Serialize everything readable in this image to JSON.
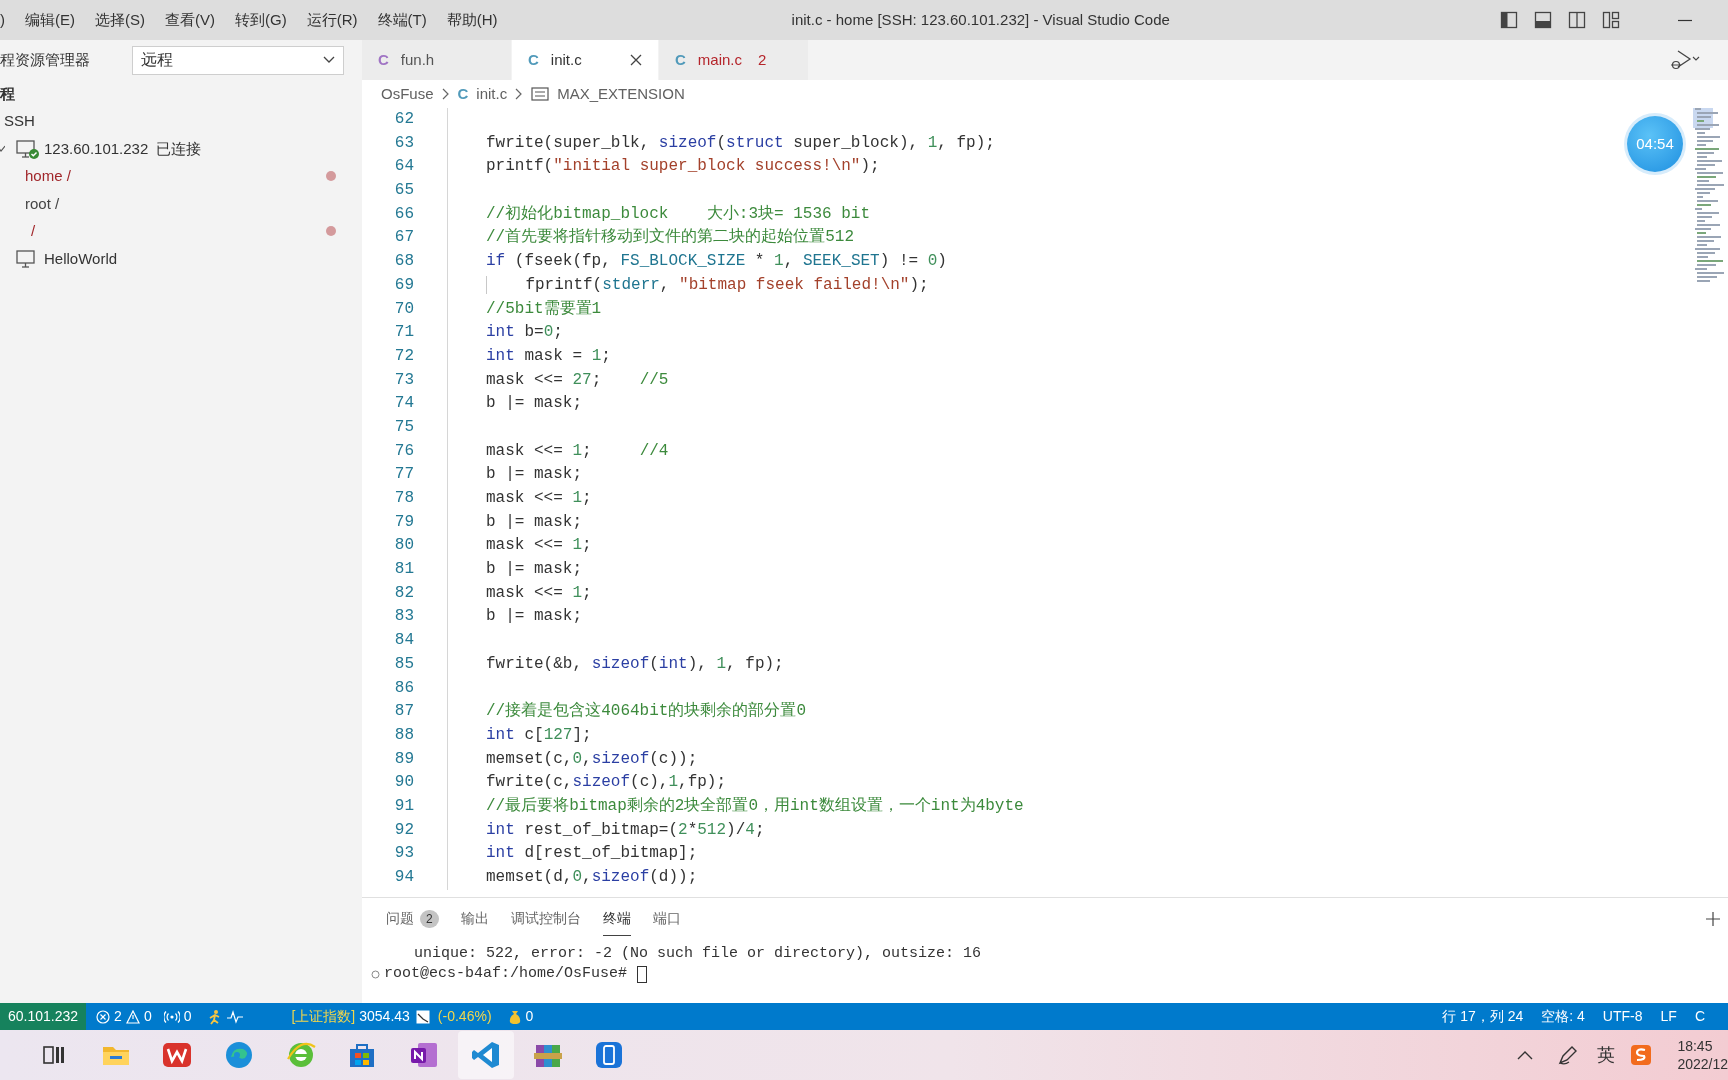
{
  "window": {
    "title": "init.c - home [SSH: 123.60.101.232] - Visual Studio Code"
  },
  "menu": [
    ")",
    "编辑(E)",
    "选择(S)",
    "查看(V)",
    "转到(G)",
    "运行(R)",
    "终端(T)",
    "帮助(H)"
  ],
  "sidebar": {
    "header": "程资源管理器",
    "dropdown": {
      "value": "远程"
    },
    "section": "程",
    "group": "SSH",
    "hosts": [
      {
        "label": "123.60.101.232",
        "status": "已连接",
        "connected": true,
        "expanded": true,
        "children": [
          {
            "name": "home",
            "separator": "/",
            "modified": true
          },
          {
            "name": "root",
            "separator": "/",
            "modified": false
          },
          {
            "separator": "/",
            "modified": true
          }
        ]
      },
      {
        "label": "HelloWorld",
        "connected": false
      }
    ]
  },
  "tabs": [
    {
      "label": "fun.h",
      "icon": "C",
      "color": "#a074c4",
      "selected": false
    },
    {
      "label": "init.c",
      "icon": "C",
      "color": "#519aba",
      "selected": true
    },
    {
      "label": "main.c",
      "icon": "C",
      "color": "#519aba",
      "selected": false,
      "problems": "2"
    }
  ],
  "breadcrumb": [
    {
      "kind": "folder",
      "text": "OsFuse"
    },
    {
      "kind": "file",
      "icon": "C",
      "text": "init.c"
    },
    {
      "kind": "symbol",
      "text": "MAX_EXTENSION"
    }
  ],
  "editor": {
    "lines": [
      {
        "number": "62"
      },
      {
        "number": "63",
        "tokens": [
          {
            "kind": "text",
            "text": "fwrite(super_blk, "
          },
          {
            "kind": "keyword",
            "text": "sizeof"
          },
          {
            "kind": "text",
            "text": "("
          },
          {
            "kind": "keyword",
            "text": "struct"
          },
          {
            "kind": "text",
            "text": " super_block), "
          },
          {
            "kind": "number",
            "text": "1"
          },
          {
            "kind": "text",
            "text": ", fp);"
          }
        ]
      },
      {
        "number": "64",
        "tokens": [
          {
            "kind": "text",
            "text": "printf("
          },
          {
            "kind": "string",
            "text": "\"initial super_block success!\\n\""
          },
          {
            "kind": "text",
            "text": ");"
          }
        ]
      },
      {
        "number": "65"
      },
      {
        "number": "66",
        "tokens": [
          {
            "kind": "comment",
            "text": "//初始化bitmap_block    大小:3块= 1536 bit"
          }
        ]
      },
      {
        "number": "67",
        "tokens": [
          {
            "kind": "comment",
            "text": "//首先要将指针移动到文件的第二块的起始位置512"
          }
        ]
      },
      {
        "number": "68",
        "tokens": [
          {
            "kind": "keyword",
            "text": "if"
          },
          {
            "kind": "text",
            "text": " (fseek(fp, "
          },
          {
            "kind": "constant",
            "text": "FS_BLOCK_SIZE"
          },
          {
            "kind": "text",
            "text": " * "
          },
          {
            "kind": "number",
            "text": "1"
          },
          {
            "kind": "text",
            "text": ", "
          },
          {
            "kind": "constant",
            "text": "SEEK_SET"
          },
          {
            "kind": "text",
            "text": ") != "
          },
          {
            "kind": "number",
            "text": "0"
          },
          {
            "kind": "text",
            "text": ")"
          }
        ]
      },
      {
        "number": "69",
        "indent_guide": true,
        "tokens": [
          {
            "kind": "text",
            "text": "    fprintf("
          },
          {
            "kind": "constant",
            "text": "stderr"
          },
          {
            "kind": "text",
            "text": ", "
          },
          {
            "kind": "string",
            "text": "\"bitmap fseek failed!\\n\""
          },
          {
            "kind": "text",
            "text": ");"
          }
        ]
      },
      {
        "number": "70",
        "tokens": [
          {
            "kind": "comment",
            "text": "//5bit需要置1"
          }
        ]
      },
      {
        "number": "71",
        "tokens": [
          {
            "kind": "keyword",
            "text": "int"
          },
          {
            "kind": "text",
            "text": " b="
          },
          {
            "kind": "number",
            "text": "0"
          },
          {
            "kind": "text",
            "text": ";"
          }
        ]
      },
      {
        "number": "72",
        "tokens": [
          {
            "kind": "keyword",
            "text": "int"
          },
          {
            "kind": "text",
            "text": " mask = "
          },
          {
            "kind": "number",
            "text": "1"
          },
          {
            "kind": "text",
            "text": ";"
          }
        ]
      },
      {
        "number": "73",
        "tokens": [
          {
            "kind": "text",
            "text": "mask <<= "
          },
          {
            "kind": "number",
            "text": "27"
          },
          {
            "kind": "text",
            "text": ";    "
          },
          {
            "kind": "comment",
            "text": "//5"
          }
        ]
      },
      {
        "number": "74",
        "tokens": [
          {
            "kind": "text",
            "text": "b |= mask;"
          }
        ]
      },
      {
        "number": "75"
      },
      {
        "number": "76",
        "tokens": [
          {
            "kind": "text",
            "text": "mask <<= "
          },
          {
            "kind": "number",
            "text": "1"
          },
          {
            "kind": "text",
            "text": ";     "
          },
          {
            "kind": "comment",
            "text": "//4"
          }
        ]
      },
      {
        "number": "77",
        "tokens": [
          {
            "kind": "text",
            "text": "b |= mask;"
          }
        ]
      },
      {
        "number": "78",
        "tokens": [
          {
            "kind": "text",
            "text": "mask <<= "
          },
          {
            "kind": "number",
            "text": "1"
          },
          {
            "kind": "text",
            "text": ";"
          }
        ]
      },
      {
        "number": "79",
        "tokens": [
          {
            "kind": "text",
            "text": "b |= mask;"
          }
        ]
      },
      {
        "number": "80",
        "tokens": [
          {
            "kind": "text",
            "text": "mask <<= "
          },
          {
            "kind": "number",
            "text": "1"
          },
          {
            "kind": "text",
            "text": ";"
          }
        ]
      },
      {
        "number": "81",
        "tokens": [
          {
            "kind": "text",
            "text": "b |= mask;"
          }
        ]
      },
      {
        "number": "82",
        "tokens": [
          {
            "kind": "text",
            "text": "mask <<= "
          },
          {
            "kind": "number",
            "text": "1"
          },
          {
            "kind": "text",
            "text": ";"
          }
        ]
      },
      {
        "number": "83",
        "tokens": [
          {
            "kind": "text",
            "text": "b |= mask;"
          }
        ]
      },
      {
        "number": "84"
      },
      {
        "number": "85",
        "tokens": [
          {
            "kind": "text",
            "text": "fwrite(&b, "
          },
          {
            "kind": "keyword",
            "text": "sizeof"
          },
          {
            "kind": "text",
            "text": "("
          },
          {
            "kind": "keyword",
            "text": "int"
          },
          {
            "kind": "text",
            "text": "), "
          },
          {
            "kind": "number",
            "text": "1"
          },
          {
            "kind": "text",
            "text": ", fp);"
          }
        ]
      },
      {
        "number": "86"
      },
      {
        "number": "87",
        "tokens": [
          {
            "kind": "comment",
            "text": "//接着是包含这4064bit的块剩余的部分置0"
          }
        ]
      },
      {
        "number": "88",
        "tokens": [
          {
            "kind": "keyword",
            "text": "int"
          },
          {
            "kind": "text",
            "text": " c["
          },
          {
            "kind": "number",
            "text": "127"
          },
          {
            "kind": "text",
            "text": "];"
          }
        ]
      },
      {
        "number": "89",
        "tokens": [
          {
            "kind": "text",
            "text": "memset(c,"
          },
          {
            "kind": "number",
            "text": "0"
          },
          {
            "kind": "text",
            "text": ","
          },
          {
            "kind": "keyword",
            "text": "sizeof"
          },
          {
            "kind": "text",
            "text": "(c));"
          }
        ]
      },
      {
        "number": "90",
        "tokens": [
          {
            "kind": "text",
            "text": "fwrite(c,"
          },
          {
            "kind": "keyword",
            "text": "sizeof"
          },
          {
            "kind": "text",
            "text": "(c),"
          },
          {
            "kind": "number",
            "text": "1"
          },
          {
            "kind": "text",
            "text": ",fp);"
          }
        ]
      },
      {
        "number": "91",
        "tokens": [
          {
            "kind": "comment",
            "text": "//最后要将bitmap剩余的2块全部置0，用int数组设置，一个int为4byte"
          }
        ]
      },
      {
        "number": "92",
        "tokens": [
          {
            "kind": "keyword",
            "text": "int"
          },
          {
            "kind": "text",
            "text": " rest_of_bitmap=("
          },
          {
            "kind": "number",
            "text": "2"
          },
          {
            "kind": "text",
            "text": "*"
          },
          {
            "kind": "number",
            "text": "512"
          },
          {
            "kind": "text",
            "text": ")/"
          },
          {
            "kind": "number",
            "text": "4"
          },
          {
            "kind": "text",
            "text": ";"
          }
        ]
      },
      {
        "number": "93",
        "tokens": [
          {
            "kind": "keyword",
            "text": "int"
          },
          {
            "kind": "text",
            "text": " d[rest_of_bitmap];"
          }
        ]
      },
      {
        "number": "94",
        "tokens": [
          {
            "kind": "text",
            "text": "memset(d,"
          },
          {
            "kind": "number",
            "text": "0"
          },
          {
            "kind": "text",
            "text": ","
          },
          {
            "kind": "keyword",
            "text": "sizeof"
          },
          {
            "kind": "text",
            "text": "(d));"
          }
        ]
      }
    ]
  },
  "timer": "04:54",
  "panel": {
    "tabs": [
      {
        "label": "问题",
        "badge": "2",
        "selected": false
      },
      {
        "label": "输出",
        "selected": false
      },
      {
        "label": "调试控制台",
        "selected": false
      },
      {
        "label": "终端",
        "selected": true
      },
      {
        "label": "端口",
        "selected": false
      }
    ],
    "terminal": [
      {
        "kind": "output",
        "text": "unique: 522, error: -2 (No such file or directory), outsize: 16"
      },
      {
        "kind": "prompt",
        "text": "root@ecs-b4af:/home/OsFuse#"
      }
    ]
  },
  "status_bar": {
    "remote": "60.101.232",
    "errors": "2",
    "warnings": "0",
    "ports": "0",
    "stock_label": "[上证指数]",
    "stock_value": "3054.43",
    "stock_change": "(-0.46%)",
    "coins": "0",
    "right": [
      "行 17，列 24",
      "空格: 4",
      "UTF-8",
      "LF",
      "C"
    ]
  },
  "taskbar": {
    "apps": [
      {
        "kind": "taskview",
        "selected": false
      },
      {
        "kind": "explorer",
        "selected": false
      },
      {
        "kind": "wps",
        "selected": false
      },
      {
        "kind": "edge",
        "selected": false
      },
      {
        "kind": "ie",
        "selected": false
      },
      {
        "kind": "store",
        "selected": false
      },
      {
        "kind": "onenote",
        "selected": false
      },
      {
        "kind": "vscode",
        "selected": true
      },
      {
        "kind": "archive",
        "selected": false
      },
      {
        "kind": "phone",
        "selected": false
      }
    ],
    "ime": "英",
    "time": "18:45",
    "date": "2022/12"
  }
}
